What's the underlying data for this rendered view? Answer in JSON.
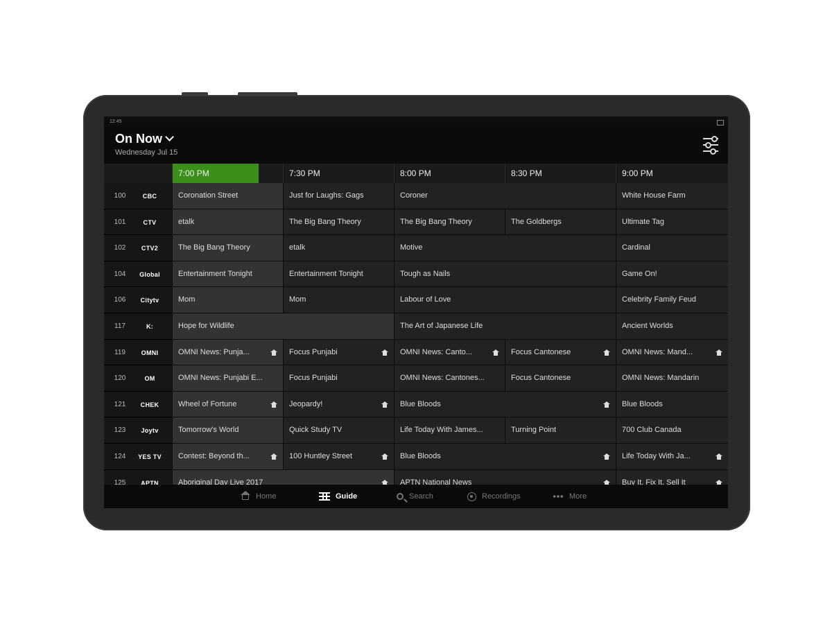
{
  "status": {
    "time": "12:45"
  },
  "header": {
    "title": "On Now",
    "date": "Wednesday Jul 15"
  },
  "timebar": [
    "7:00 PM",
    "7:30 PM",
    "8:00 PM",
    "8:30 PM",
    "9:00 PM"
  ],
  "colors": {
    "accent": "#3c8e1a",
    "background": "#0e0e0e",
    "cell": "#222222",
    "current_cell": "#333333"
  },
  "channels": [
    {
      "num": "100",
      "logo": "CBC",
      "programs": [
        {
          "title": "Coronation Street",
          "span": [
            0,
            1
          ],
          "current": true
        },
        {
          "title": "Just for Laughs: Gags",
          "span": [
            1,
            2
          ]
        },
        {
          "title": "Coroner",
          "span": [
            2,
            4
          ]
        },
        {
          "title": "White House Farm",
          "span": [
            4,
            5
          ]
        }
      ]
    },
    {
      "num": "101",
      "logo": "CTV",
      "programs": [
        {
          "title": "etalk",
          "span": [
            0,
            1
          ],
          "current": true
        },
        {
          "title": "The Big Bang Theory",
          "span": [
            1,
            2
          ]
        },
        {
          "title": "The Big Bang Theory",
          "span": [
            2,
            3
          ]
        },
        {
          "title": "The Goldbergs",
          "span": [
            3,
            4
          ]
        },
        {
          "title": "Ultimate Tag",
          "span": [
            4,
            5
          ]
        }
      ]
    },
    {
      "num": "102",
      "logo": "CTV2",
      "programs": [
        {
          "title": "The Big Bang Theory",
          "span": [
            0,
            1
          ],
          "current": true
        },
        {
          "title": "etalk",
          "span": [
            1,
            2
          ]
        },
        {
          "title": "Motive",
          "span": [
            2,
            4
          ]
        },
        {
          "title": "Cardinal",
          "span": [
            4,
            5
          ]
        }
      ]
    },
    {
      "num": "104",
      "logo": "Global",
      "programs": [
        {
          "title": "Entertainment Tonight",
          "span": [
            0,
            1
          ],
          "current": true
        },
        {
          "title": "Entertainment Tonight",
          "span": [
            1,
            2
          ]
        },
        {
          "title": "Tough as Nails",
          "span": [
            2,
            4
          ]
        },
        {
          "title": "Game On!",
          "span": [
            4,
            5
          ]
        }
      ]
    },
    {
      "num": "106",
      "logo": "Citytv",
      "programs": [
        {
          "title": "Mom",
          "span": [
            0,
            1
          ],
          "current": true
        },
        {
          "title": "Mom",
          "span": [
            1,
            2
          ]
        },
        {
          "title": "Labour of Love",
          "span": [
            2,
            4
          ]
        },
        {
          "title": "Celebrity Family Feud",
          "span": [
            4,
            5
          ]
        }
      ]
    },
    {
      "num": "117",
      "logo": "K:",
      "programs": [
        {
          "title": "Hope for Wildlife",
          "span": [
            0,
            2
          ],
          "current": true
        },
        {
          "title": "The Art of Japanese Life",
          "span": [
            2,
            4
          ]
        },
        {
          "title": "Ancient Worlds",
          "span": [
            4,
            5
          ]
        }
      ]
    },
    {
      "num": "119",
      "logo": "OMNI",
      "programs": [
        {
          "title": "OMNI News: Punja...",
          "span": [
            0,
            1
          ],
          "current": true,
          "home": true
        },
        {
          "title": "Focus Punjabi",
          "span": [
            1,
            2
          ],
          "home": true
        },
        {
          "title": "OMNI News: Canto...",
          "span": [
            2,
            3
          ],
          "home": true
        },
        {
          "title": "Focus Cantonese",
          "span": [
            3,
            4
          ],
          "home": true
        },
        {
          "title": "OMNI News: Mand...",
          "span": [
            4,
            5
          ],
          "home": true
        }
      ]
    },
    {
      "num": "120",
      "logo": "OM",
      "programs": [
        {
          "title": "OMNI News: Punjabi E...",
          "span": [
            0,
            1
          ],
          "current": true
        },
        {
          "title": "Focus Punjabi",
          "span": [
            1,
            2
          ]
        },
        {
          "title": "OMNI News: Cantones...",
          "span": [
            2,
            3
          ]
        },
        {
          "title": "Focus Cantonese",
          "span": [
            3,
            4
          ]
        },
        {
          "title": "OMNI News: Mandarin",
          "span": [
            4,
            5
          ]
        }
      ]
    },
    {
      "num": "121",
      "logo": "CHEK",
      "programs": [
        {
          "title": "Wheel of Fortune",
          "span": [
            0,
            1
          ],
          "current": true,
          "home": true
        },
        {
          "title": "Jeopardy!",
          "span": [
            1,
            2
          ],
          "home": true
        },
        {
          "title": "Blue Bloods",
          "span": [
            2,
            4
          ],
          "home": true
        },
        {
          "title": "Blue Bloods",
          "span": [
            4,
            5
          ]
        }
      ]
    },
    {
      "num": "123",
      "logo": "Joytv",
      "programs": [
        {
          "title": "Tomorrow's World",
          "span": [
            0,
            1
          ],
          "current": true
        },
        {
          "title": "Quick Study TV",
          "span": [
            1,
            2
          ]
        },
        {
          "title": "Life Today With James...",
          "span": [
            2,
            3
          ]
        },
        {
          "title": "Turning Point",
          "span": [
            3,
            4
          ]
        },
        {
          "title": "700 Club Canada",
          "span": [
            4,
            5
          ]
        }
      ]
    },
    {
      "num": "124",
      "logo": "YES TV",
      "programs": [
        {
          "title": "Contest: Beyond th...",
          "span": [
            0,
            1
          ],
          "current": true,
          "home": true
        },
        {
          "title": "100 Huntley Street",
          "span": [
            1,
            2
          ],
          "home": true
        },
        {
          "title": "Blue Bloods",
          "span": [
            2,
            4
          ],
          "home": true
        },
        {
          "title": "Life Today With Ja...",
          "span": [
            4,
            5
          ],
          "home": true
        }
      ]
    },
    {
      "num": "125",
      "logo": "APTN",
      "programs": [
        {
          "title": "Aboriginal Day Live 2017",
          "span": [
            0,
            2
          ],
          "current": true,
          "home": true
        },
        {
          "title": "APTN National News",
          "span": [
            2,
            4
          ],
          "home": true
        },
        {
          "title": "Buy It, Fix It, Sell It",
          "span": [
            4,
            5
          ],
          "home": true
        }
      ]
    }
  ],
  "nav": [
    {
      "id": "home",
      "label": "Home",
      "icon": "home-icon"
    },
    {
      "id": "guide",
      "label": "Guide",
      "icon": "guide-icon",
      "active": true
    },
    {
      "id": "search",
      "label": "Search",
      "icon": "search-icon"
    },
    {
      "id": "recordings",
      "label": "Recordings",
      "icon": "recordings-icon"
    },
    {
      "id": "more",
      "label": "More",
      "icon": "more-icon"
    }
  ]
}
